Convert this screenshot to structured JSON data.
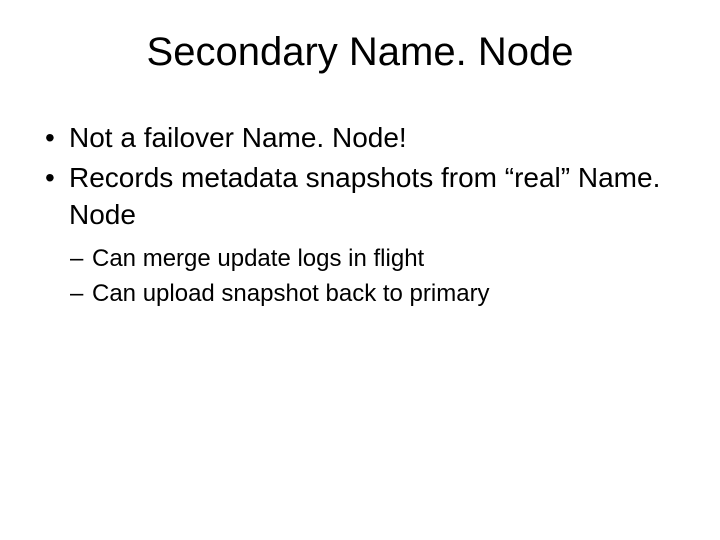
{
  "slide": {
    "title": "Secondary Name. Node",
    "bullets": [
      {
        "text": "Not a failover Name. Node!"
      },
      {
        "text": "Records metadata snapshots from “real” Name. Node"
      }
    ],
    "subBullets": [
      {
        "text": "Can merge update logs in flight"
      },
      {
        "text": "Can upload snapshot back to primary"
      }
    ]
  }
}
